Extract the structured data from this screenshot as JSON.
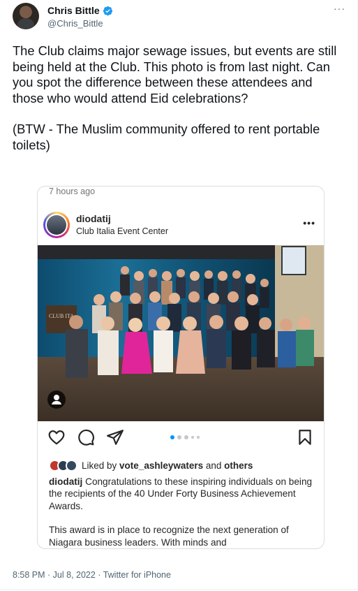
{
  "author": {
    "display_name": "Chris Bittle",
    "handle": "@Chris_Bittle",
    "verified": true
  },
  "more_icon": "···",
  "tweet": {
    "paragraph1": "The Club claims major sewage issues, but events are still being held at the Club. This photo is from last night. Can you spot the difference between these attendees and those who would attend Eid celebrations?",
    "paragraph2": "(BTW - The Muslim community offered to rent portable toilets)"
  },
  "embed": {
    "time_ago": "7 hours ago",
    "username": "diodatij",
    "location": "Club Italia Event Center",
    "more_icon": "•••",
    "photo_sign": "CLUB ITA",
    "likes": {
      "prefix": "Liked by ",
      "user": "vote_ashleywaters",
      "middle": " and ",
      "others": "others"
    },
    "caption": {
      "username": "diodatij",
      "text1": " Congratulations to these inspiring individuals on being the recipients of the 40 Under Forty Business Achievement Awards.",
      "text2": "This award is in place to recognize the next generation of Niagara business leaders. With minds and"
    },
    "carousel": {
      "total_dots": 5,
      "active_index": 0
    }
  },
  "meta": {
    "timestamp": "8:58 PM · Jul 8, 2022 · Twitter for iPhone"
  },
  "colors": {
    "twitter_text": "#0f1419",
    "twitter_secondary": "#536471",
    "verified_blue": "#1d9bf0",
    "instagram_blue": "#0095f6"
  },
  "icons": [
    "verified-badge-icon",
    "more-icon",
    "heart-icon",
    "comment-icon",
    "share-icon",
    "bookmark-icon",
    "user-tag-icon"
  ]
}
